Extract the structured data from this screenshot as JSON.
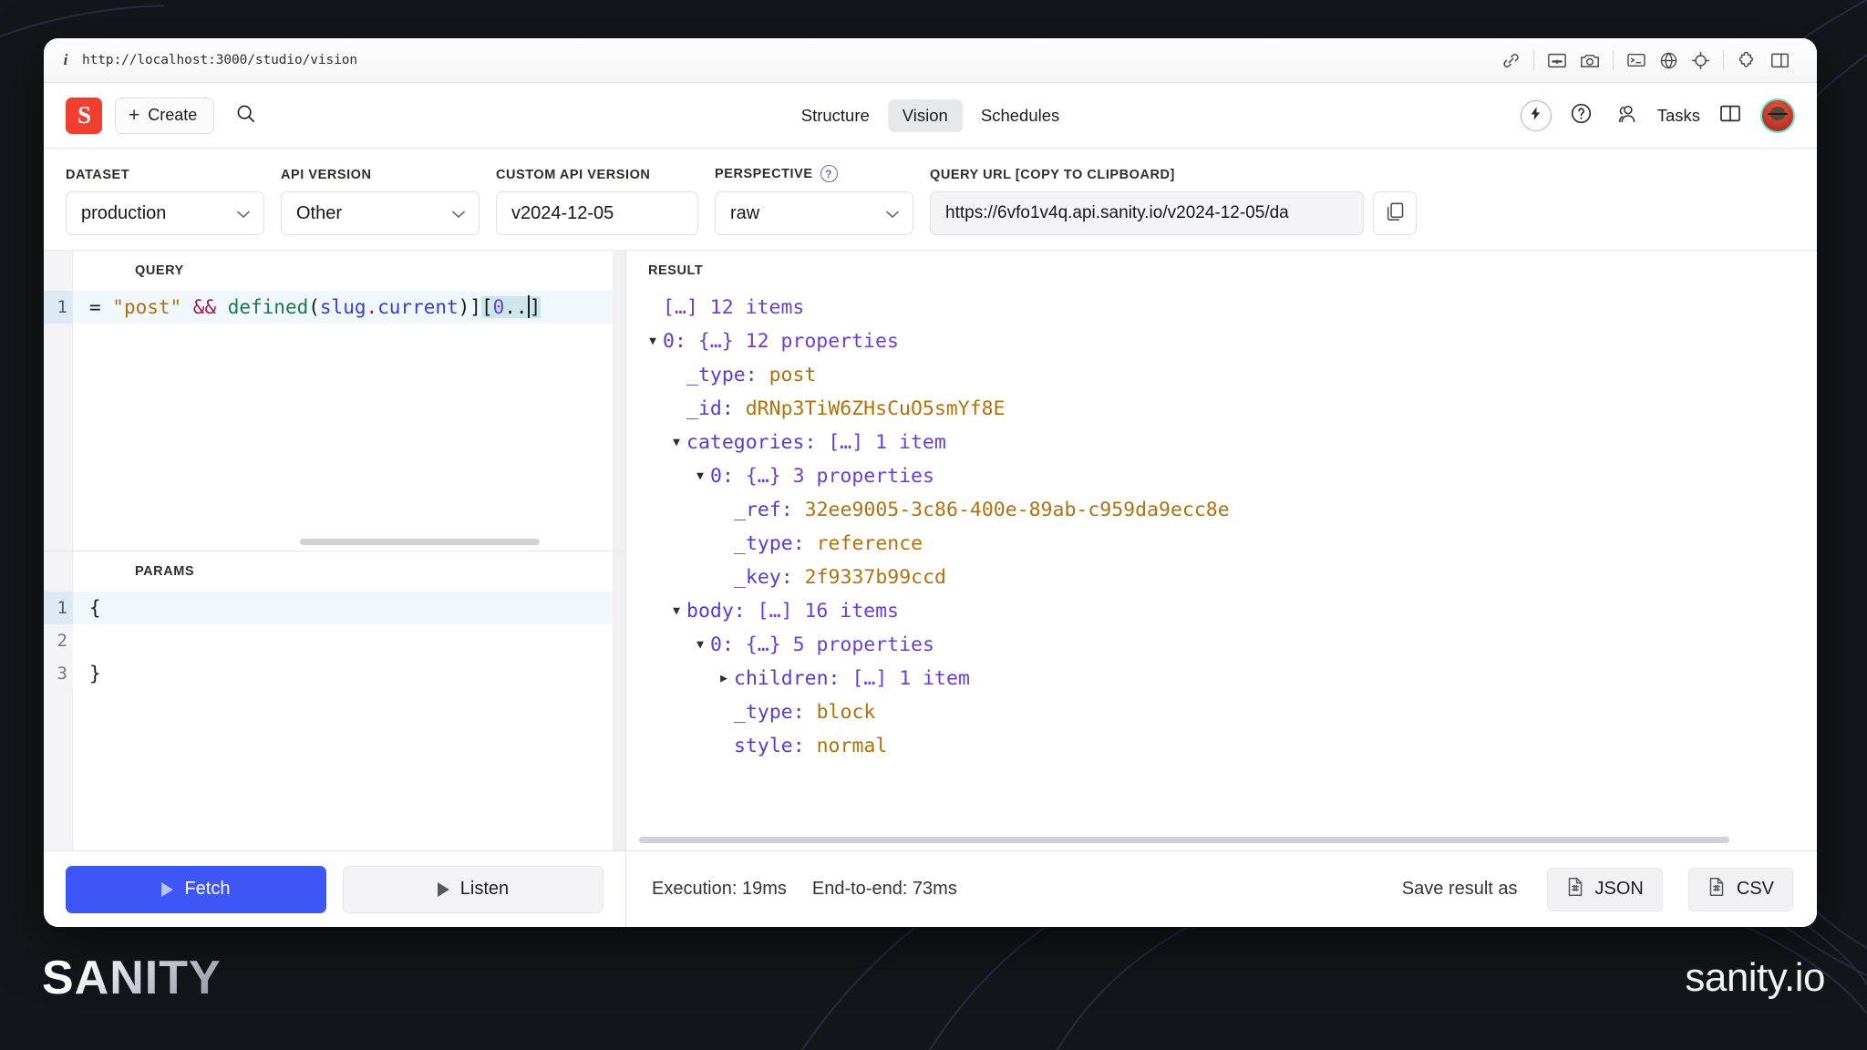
{
  "browser": {
    "url": "http://localhost:3000/studio/vision",
    "info_icon": "info-icon",
    "toolbar_icons": [
      "link-icon",
      "image-capture-icon",
      "camera-icon",
      "terminal-icon",
      "globe-icon",
      "target-icon",
      "puzzle-icon",
      "sidebar-panel-icon"
    ]
  },
  "header": {
    "logo_letter": "S",
    "create_label": "Create",
    "create_plus": "+",
    "search_icon": "search-icon",
    "tabs": [
      {
        "label": "Structure",
        "active": false
      },
      {
        "label": "Vision",
        "active": true
      },
      {
        "label": "Schedules",
        "active": false
      }
    ],
    "tasks_label": "Tasks",
    "right_icons": [
      "lightning-icon",
      "help-circle-icon",
      "users-icon",
      "sidebar-toggle-icon",
      "avatar"
    ]
  },
  "options": {
    "dataset": {
      "label": "DATASET",
      "value": "production"
    },
    "api_version": {
      "label": "API VERSION",
      "value": "Other"
    },
    "custom_api_version": {
      "label": "CUSTOM API VERSION",
      "value": "v2024-12-05"
    },
    "perspective": {
      "label": "PERSPECTIVE",
      "value": "raw",
      "help": "?"
    },
    "query_url": {
      "label": "QUERY URL [COPY TO CLIPBOARD]",
      "value": "https://6vfo1v4q.api.sanity.io/v2024-12-05/da",
      "copy_icon": "copy-icon"
    }
  },
  "query_editor": {
    "caption": "QUERY",
    "line_number": "1",
    "segments": [
      {
        "text": "= ",
        "kind": "punc"
      },
      {
        "text": "\"post\"",
        "kind": "str"
      },
      {
        "text": " && ",
        "kind": "op"
      },
      {
        "text": "defined",
        "kind": "fn"
      },
      {
        "text": "(",
        "kind": "punc"
      },
      {
        "text": "slug",
        "kind": "prop"
      },
      {
        "text": ".",
        "kind": "op"
      },
      {
        "text": "current",
        "kind": "prop"
      },
      {
        "text": ")]",
        "kind": "punc"
      },
      {
        "text": "[",
        "kind": "sel-punc"
      },
      {
        "text": "0",
        "kind": "sel-num"
      },
      {
        "text": "..",
        "kind": "sel-punc"
      },
      {
        "text": "]",
        "kind": "sel-punc"
      }
    ]
  },
  "params_editor": {
    "caption": "PARAMS",
    "lines": [
      {
        "n": "1",
        "text": "{",
        "highlight": true
      },
      {
        "n": "2",
        "text": "",
        "highlight": false
      },
      {
        "n": "3",
        "text": "}",
        "highlight": false
      }
    ]
  },
  "result": {
    "caption": "RESULT",
    "rows": [
      {
        "indent": 0,
        "arrow": "",
        "key": "",
        "meta": "[…] 12 items",
        "value": ""
      },
      {
        "indent": 0,
        "arrow": "▼",
        "key": "0:",
        "meta": "{…} 12 properties",
        "value": ""
      },
      {
        "indent": 1,
        "arrow": "",
        "key": "_type:",
        "meta": "",
        "value": "post"
      },
      {
        "indent": 1,
        "arrow": "",
        "key": "_id:",
        "meta": "",
        "value": "dRNp3TiW6ZHsCuO5smYf8E"
      },
      {
        "indent": 1,
        "arrow": "▼",
        "key": "categories:",
        "meta": "[…] 1 item",
        "value": ""
      },
      {
        "indent": 2,
        "arrow": "▼",
        "key": "0:",
        "meta": "{…} 3 properties",
        "value": ""
      },
      {
        "indent": 3,
        "arrow": "",
        "key": "_ref:",
        "meta": "",
        "value": "32ee9005-3c86-400e-89ab-c959da9ecc8e"
      },
      {
        "indent": 3,
        "arrow": "",
        "key": "_type:",
        "meta": "",
        "value": "reference"
      },
      {
        "indent": 3,
        "arrow": "",
        "key": "_key:",
        "meta": "",
        "value": "2f9337b99ccd"
      },
      {
        "indent": 1,
        "arrow": "▼",
        "key": "body:",
        "meta": "[…] 16 items",
        "value": ""
      },
      {
        "indent": 2,
        "arrow": "▼",
        "key": "0:",
        "meta": "{…} 5 properties",
        "value": ""
      },
      {
        "indent": 3,
        "arrow": "▶",
        "key": "children:",
        "meta": "[…] 1 item",
        "value": ""
      },
      {
        "indent": 3,
        "arrow": "",
        "key": "_type:",
        "meta": "",
        "value": "block"
      },
      {
        "indent": 3,
        "arrow": "",
        "key": "style:",
        "meta": "",
        "value": "normal"
      }
    ]
  },
  "footer": {
    "fetch_label": "Fetch",
    "listen_label": "Listen",
    "execution": "Execution: 19ms",
    "end_to_end": "End-to-end: 73ms",
    "save_result_as": "Save result as",
    "json_label": "JSON",
    "csv_label": "CSV",
    "file_icon": "file-grid-icon"
  },
  "brand": {
    "left": "SANITY",
    "right": "sanity.io"
  },
  "colors": {
    "accent_blue": "#3d56f5",
    "logo_red": "#f03e2f",
    "page_bg": "#14161b",
    "tab_active_bg": "#e7e8ea"
  }
}
